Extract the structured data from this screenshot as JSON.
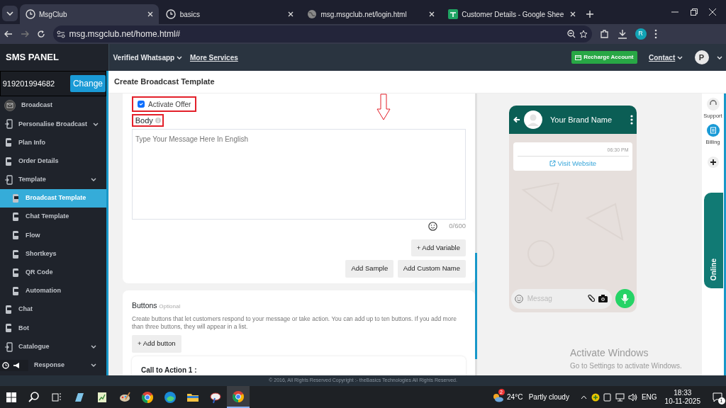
{
  "browser": {
    "tabs": [
      {
        "title": "MsgClub",
        "selected": true,
        "kind": "clock"
      },
      {
        "title": "basics",
        "selected": false,
        "kind": "clock"
      },
      {
        "title": "msg.msgclub.net/login.html",
        "selected": false,
        "kind": "globe"
      },
      {
        "title": "Customer Details - Google Shee",
        "selected": false,
        "kind": "sheet"
      }
    ],
    "url": "msg.msgclub.net/home.html#",
    "profile": "R"
  },
  "app": {
    "brand": "SMS PANEL",
    "phone_number": "919201994682",
    "change_button": "Change",
    "nav": [
      {
        "label": "Verified Whatsapp",
        "kind": "dropdown"
      },
      {
        "label": "More Services",
        "kind": "link"
      }
    ],
    "recharge_button": "Recharge Account",
    "contact": "Contact",
    "avatar": "P"
  },
  "sidebar": {
    "items": [
      {
        "label": "Broadcast",
        "kind": "mail",
        "selected": false
      },
      {
        "label": "Personalise Broadcast",
        "kind": "group",
        "selected": false
      },
      {
        "label": "Plan Info",
        "kind": "page",
        "selected": false
      },
      {
        "label": "Order Details",
        "kind": "page",
        "selected": false
      },
      {
        "label": "Template",
        "kind": "group",
        "selected": false,
        "children": [
          {
            "label": "Broadcast Template",
            "kind": "page",
            "selected": true
          },
          {
            "label": "Chat Template",
            "kind": "page",
            "selected": false
          },
          {
            "label": "Flow",
            "kind": "page",
            "selected": false
          },
          {
            "label": "Shortkeys",
            "kind": "page",
            "selected": false
          },
          {
            "label": "QR Code",
            "kind": "page",
            "selected": false
          },
          {
            "label": "Automation",
            "kind": "page",
            "selected": false
          }
        ]
      },
      {
        "label": "Chat",
        "kind": "page",
        "selected": false
      },
      {
        "label": "Bot",
        "kind": "page",
        "selected": false
      },
      {
        "label": "Catalogue",
        "kind": "group",
        "selected": false
      },
      {
        "label": "Response",
        "kind": "group",
        "selected": false
      }
    ]
  },
  "page": {
    "title": "Create Broadcast Template",
    "activate_offer": {
      "label": "Activate Offer",
      "checked": true
    },
    "body": {
      "label": "Body",
      "placeholder": "Type Your Message Here In English",
      "counter": "0/600"
    },
    "add_variable": "+ Add Variable",
    "add_sample": "Add Sample",
    "add_custom_name": "Add Custom Name",
    "buttons_section": {
      "title": "Buttons",
      "optional": "Optional",
      "description": "Create buttons that let customers respond to your message or take action. You can add up to ten buttons. If you add more than three buttons, they will appear in a list.",
      "add_button": "+ Add button",
      "call_to_action": "Call to Action 1 :"
    }
  },
  "preview": {
    "brand_name": "Your Brand Name",
    "time": "06:30 PM",
    "link": "Visit Website",
    "message_placeholder": "Messag"
  },
  "right_rail": {
    "support": "Support",
    "billing": "Billing",
    "online": "Online"
  },
  "footer": "© 2016, All Rights Reserved Copyright :- theBasics Technologies All Rights Reserved.",
  "activation": {
    "title": "Activate Windows",
    "subtitle": "Go to Settings to activate Windows."
  },
  "taskbar": {
    "weather_badge": "2",
    "temperature": "24°C",
    "weather": "Partly cloudy",
    "language": "ENG",
    "time": "18:33",
    "date": "10-11-2025",
    "notifications": "1"
  }
}
